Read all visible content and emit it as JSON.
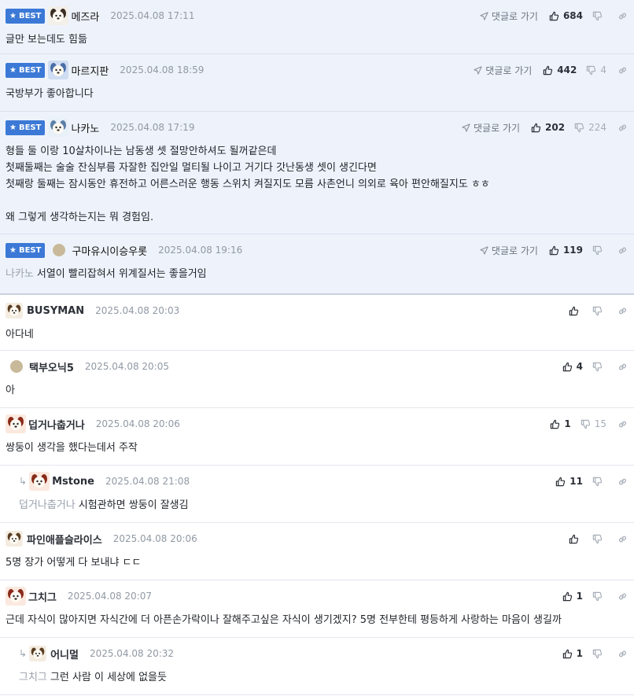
{
  "best_badge": "BEST",
  "goto_label": "댓글로 가기",
  "comments": [
    {
      "nick": "메즈라",
      "date": "2025.04.08 17:11",
      "up": "684",
      "down": "",
      "lines": [
        "글만 보는데도 힘듦"
      ]
    },
    {
      "nick": "마르지판",
      "date": "2025.04.08 18:59",
      "up": "442",
      "down": "4",
      "lines": [
        "국방부가 좋아합니다"
      ]
    },
    {
      "nick": "나카노",
      "date": "2025.04.08 17:19",
      "up": "202",
      "down": "224",
      "lines": [
        "형들 둘 이랑 10살차이나는 남동생 셋 절망안하셔도 될꺼같은데",
        "첫째둘째는 술술 잔심부름 자잘한 집안일 멀티될 나이고 거기다 갓난동생 셋이 생긴다면",
        "첫째랑 둘째는 잠시동안 휴전하고 어른스러운 행동 스위치 켜질지도 모름 사촌언니 의외로 육아 편안해질지도 ㅎㅎ",
        "",
        "왜 그렇게 생각하는지는 뭐 경험임."
      ]
    },
    {
      "nick": "구마유시이승우롯",
      "date": "2025.04.08 19:16",
      "up": "119",
      "down": "",
      "mention": "나카노",
      "lines": [
        "서열이 빨리잡혀서 위계질서는 좋을거임"
      ]
    },
    {
      "nick": "BUSYMAN",
      "date": "2025.04.08 20:03",
      "up": "",
      "down": "",
      "lines": [
        "아다네"
      ]
    },
    {
      "nick": "택부오닉5",
      "date": "2025.04.08 20:05",
      "up": "4",
      "down": "",
      "lines": [
        "아"
      ]
    },
    {
      "nick": "덥거나춥거나",
      "date": "2025.04.08 20:06",
      "up": "1",
      "down": "15",
      "lines": [
        "쌍둥이 생각을 했다는데서 주작"
      ]
    },
    {
      "nick": "Mstone",
      "date": "2025.04.08 21:08",
      "up": "11",
      "down": "",
      "mention": "덥거나춥거나",
      "lines": [
        "시험관하면 쌍둥이 잘생김"
      ]
    },
    {
      "nick": "파인애플슬라이스",
      "date": "2025.04.08 20:06",
      "up": "",
      "down": "",
      "lines": [
        "5명 장가 어떻게 다 보내냐 ㄷㄷ"
      ]
    },
    {
      "nick": "그치그",
      "date": "2025.04.08 20:07",
      "up": "1",
      "down": "",
      "lines": [
        "근데 자식이 많아지면 자식간에 더 아픈손가락이나 잘해주고싶은 자식이 생기겠지? 5명 전부한테 평등하게 사랑하는 마음이 생길까"
      ]
    },
    {
      "nick": "어니멀",
      "date": "2025.04.08 20:32",
      "up": "1",
      "down": "",
      "mention": "그치그",
      "lines": [
        "그런 사람 이 세상에 없을듯"
      ]
    }
  ],
  "icons": {
    "goto": "send-arrow-icon",
    "up": "thumbs-up-icon",
    "down": "thumbs-down-icon",
    "link": "link-icon",
    "star": "star-icon",
    "reply": "reply-arrow-icon"
  },
  "colors": {
    "best_bg": "#eef3fb",
    "best_badge": "#3c79d6",
    "muted": "#9199a4",
    "mention": "#9aa1ab"
  }
}
